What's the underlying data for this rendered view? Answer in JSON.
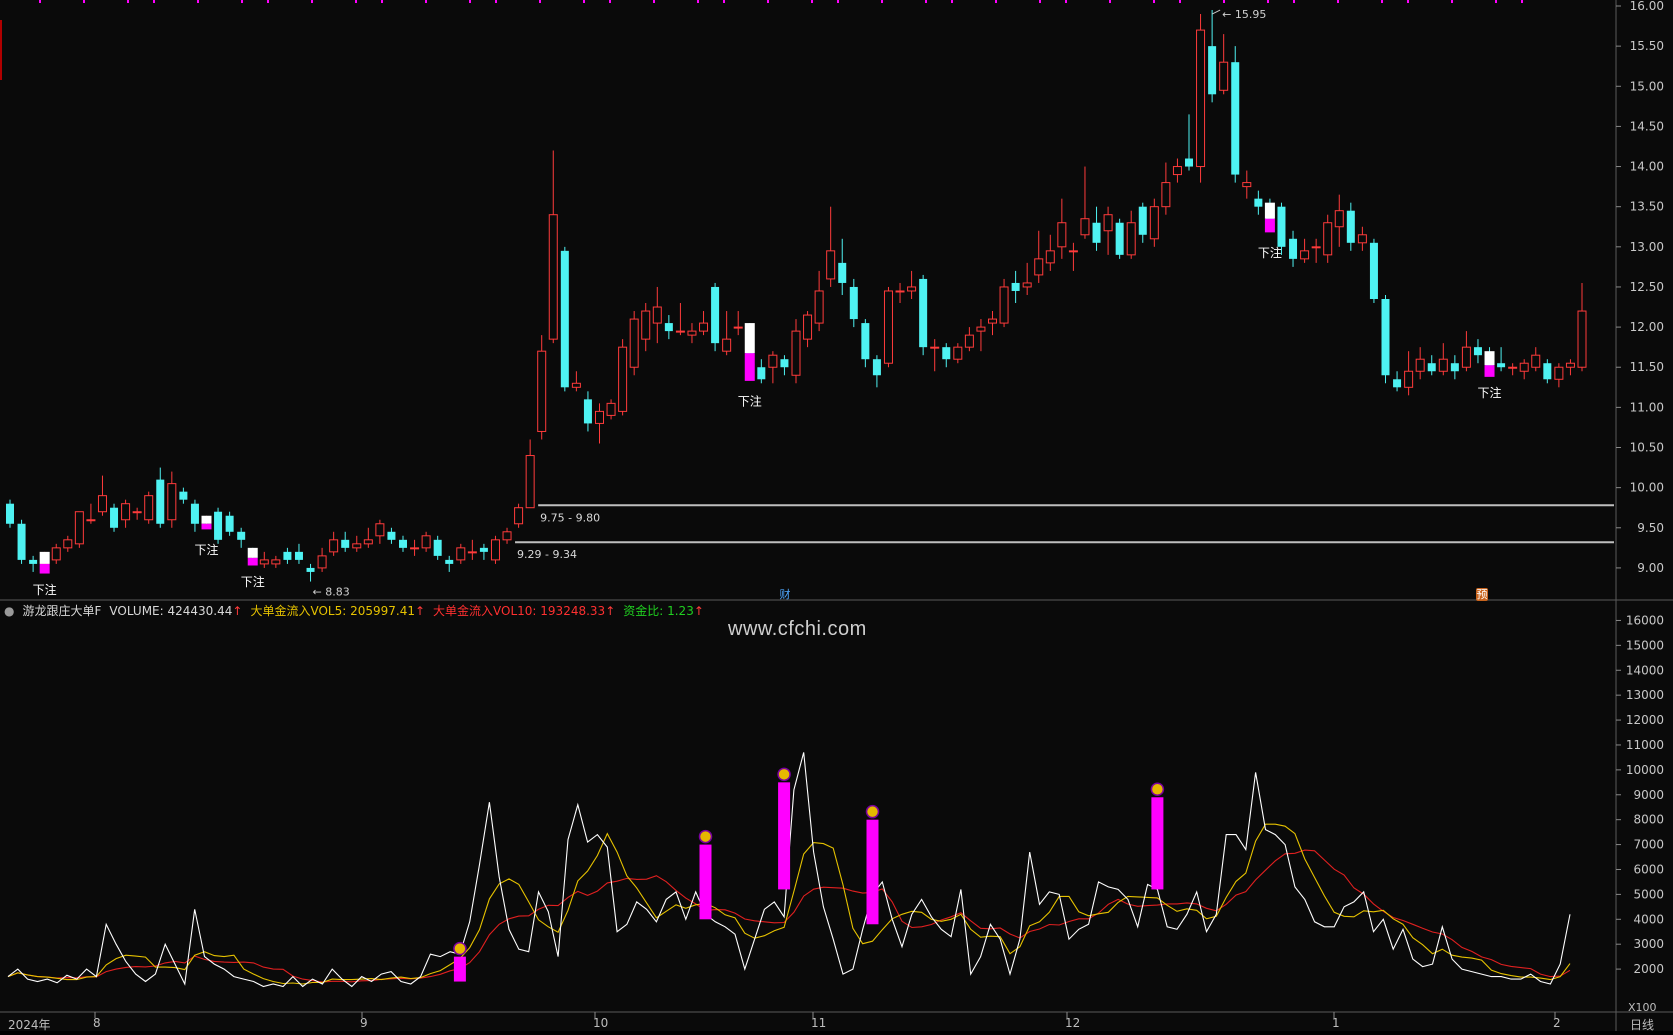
{
  "colors": {
    "up": "#ff3b3b",
    "down": "#4ef2f2",
    "bg": "#0a0a0a",
    "grid": "#2a2a2a",
    "magenta": "#ff00ff",
    "vol": "#ffffff",
    "ma5": "#e6c200",
    "ma10": "#e02020"
  },
  "indicator": {
    "name": "游龙跟庄大单F",
    "volume": "VOLUME: 424430.44",
    "vol5": "大单金流入VOL5: 205997.41",
    "vol10": "大单金流入VOL10: 193248.33",
    "ratio": "资金比: 1.23",
    "arrow": "↑"
  },
  "watermark": "www.cfchi.com",
  "x_axis": {
    "year": "2024年",
    "months": [
      "8",
      "9",
      "10",
      "11",
      "12",
      "1",
      "2"
    ]
  },
  "period": "日线",
  "vol_unit": "X100",
  "tags": {
    "cai": "财",
    "yu": "预"
  },
  "bet_label": "下注",
  "price_notes": {
    "high": "15.95",
    "low": "8.83",
    "zone1": "9.75 - 9.80",
    "zone2": "9.29 - 9.34"
  },
  "price_axis": [
    "9.00",
    "9.50",
    "10.00",
    "10.50",
    "11.00",
    "11.50",
    "12.00",
    "12.50",
    "13.00",
    "13.50",
    "14.00",
    "14.50",
    "15.00",
    "15.50",
    "16.00"
  ],
  "vol_axis": [
    "2000",
    "3000",
    "4000",
    "5000",
    "6000",
    "7000",
    "8000",
    "9000",
    "10000",
    "11000",
    "12000",
    "13000",
    "14000",
    "15000",
    "16000"
  ],
  "chart_data": {
    "type": "candlestick",
    "price_range": [
      8.7,
      16.0
    ],
    "candles": [
      [
        9.8,
        9.55,
        9.85,
        9.5
      ],
      [
        9.55,
        9.1,
        9.6,
        9.05
      ],
      [
        9.1,
        9.05,
        9.15,
        8.95
      ],
      [
        9.05,
        9.15,
        9.2,
        9.0
      ],
      [
        9.1,
        9.25,
        9.3,
        9.05
      ],
      [
        9.25,
        9.35,
        9.4,
        9.2
      ],
      [
        9.3,
        9.7,
        9.7,
        9.25
      ],
      [
        9.6,
        9.6,
        9.8,
        9.55
      ],
      [
        9.7,
        9.9,
        10.15,
        9.65
      ],
      [
        9.75,
        9.5,
        9.8,
        9.45
      ],
      [
        9.6,
        9.8,
        9.85,
        9.5
      ],
      [
        9.7,
        9.7,
        9.75,
        9.6
      ],
      [
        9.6,
        9.9,
        9.95,
        9.55
      ],
      [
        10.1,
        9.55,
        10.25,
        9.5
      ],
      [
        9.6,
        10.05,
        10.2,
        9.5
      ],
      [
        9.95,
        9.85,
        10.0,
        9.8
      ],
      [
        9.8,
        9.55,
        9.85,
        9.45
      ],
      [
        9.6,
        9.6,
        9.65,
        9.5
      ],
      [
        9.7,
        9.35,
        9.75,
        9.3
      ],
      [
        9.65,
        9.45,
        9.7,
        9.4
      ],
      [
        9.45,
        9.35,
        9.5,
        9.25
      ],
      [
        9.2,
        9.15,
        9.25,
        9.1
      ],
      [
        9.05,
        9.1,
        9.2,
        9.0
      ],
      [
        9.05,
        9.1,
        9.15,
        9.0
      ],
      [
        9.2,
        9.1,
        9.25,
        9.05
      ],
      [
        9.2,
        9.1,
        9.3,
        9.05
      ],
      [
        9.0,
        8.95,
        9.05,
        8.83
      ],
      [
        9.0,
        9.15,
        9.25,
        8.95
      ],
      [
        9.2,
        9.35,
        9.45,
        9.15
      ],
      [
        9.35,
        9.25,
        9.45,
        9.2
      ],
      [
        9.25,
        9.3,
        9.4,
        9.2
      ],
      [
        9.3,
        9.35,
        9.5,
        9.25
      ],
      [
        9.4,
        9.55,
        9.6,
        9.3
      ],
      [
        9.45,
        9.35,
        9.5,
        9.3
      ],
      [
        9.35,
        9.25,
        9.4,
        9.2
      ],
      [
        9.25,
        9.25,
        9.35,
        9.15
      ],
      [
        9.25,
        9.4,
        9.45,
        9.2
      ],
      [
        9.35,
        9.15,
        9.4,
        9.1
      ],
      [
        9.1,
        9.05,
        9.15,
        8.95
      ],
      [
        9.1,
        9.25,
        9.3,
        9.05
      ],
      [
        9.2,
        9.2,
        9.35,
        9.1
      ],
      [
        9.25,
        9.2,
        9.3,
        9.1
      ],
      [
        9.1,
        9.35,
        9.4,
        9.05
      ],
      [
        9.35,
        9.45,
        9.5,
        9.3
      ],
      [
        9.55,
        9.75,
        9.8,
        9.5
      ],
      [
        9.75,
        10.4,
        10.6,
        9.75
      ],
      [
        10.7,
        11.7,
        11.9,
        10.6
      ],
      [
        11.85,
        13.4,
        14.2,
        11.8
      ],
      [
        12.95,
        11.25,
        13.0,
        11.2
      ],
      [
        11.25,
        11.3,
        11.45,
        11.2
      ],
      [
        11.1,
        10.8,
        11.2,
        10.7
      ],
      [
        10.8,
        10.95,
        11.05,
        10.55
      ],
      [
        10.9,
        11.05,
        11.1,
        10.85
      ],
      [
        10.95,
        11.75,
        11.85,
        10.9
      ],
      [
        11.5,
        12.1,
        12.2,
        11.4
      ],
      [
        11.85,
        12.2,
        12.3,
        11.7
      ],
      [
        12.05,
        12.25,
        12.5,
        11.8
      ],
      [
        12.05,
        11.95,
        12.15,
        11.85
      ],
      [
        11.95,
        11.95,
        12.3,
        11.9
      ],
      [
        11.9,
        11.95,
        12.05,
        11.8
      ],
      [
        11.95,
        12.05,
        12.2,
        11.9
      ],
      [
        12.5,
        11.8,
        12.55,
        11.7
      ],
      [
        11.7,
        11.85,
        12.2,
        11.65
      ],
      [
        12.0,
        12.0,
        12.2,
        11.9
      ],
      [
        12.0,
        11.45,
        12.05,
        11.35
      ],
      [
        11.5,
        11.35,
        11.6,
        11.3
      ],
      [
        11.5,
        11.65,
        11.7,
        11.3
      ],
      [
        11.6,
        11.5,
        11.65,
        11.4
      ],
      [
        11.4,
        11.95,
        12.1,
        11.3
      ],
      [
        11.85,
        12.15,
        12.2,
        11.75
      ],
      [
        12.05,
        12.45,
        12.7,
        11.95
      ],
      [
        12.6,
        12.95,
        13.5,
        12.5
      ],
      [
        12.8,
        12.55,
        13.1,
        12.4
      ],
      [
        12.5,
        12.1,
        12.6,
        12.0
      ],
      [
        12.05,
        11.6,
        12.1,
        11.5
      ],
      [
        11.6,
        11.4,
        11.65,
        11.25
      ],
      [
        11.55,
        12.45,
        12.5,
        11.5
      ],
      [
        12.45,
        12.45,
        12.55,
        12.3
      ],
      [
        12.45,
        12.5,
        12.7,
        12.35
      ],
      [
        12.6,
        11.75,
        12.65,
        11.65
      ],
      [
        11.75,
        11.75,
        11.85,
        11.45
      ],
      [
        11.75,
        11.6,
        11.8,
        11.5
      ],
      [
        11.6,
        11.75,
        11.8,
        11.55
      ],
      [
        11.75,
        11.9,
        12.0,
        11.7
      ],
      [
        11.95,
        12.0,
        12.1,
        11.7
      ],
      [
        12.05,
        12.1,
        12.2,
        11.9
      ],
      [
        12.05,
        12.5,
        12.6,
        12.0
      ],
      [
        12.55,
        12.45,
        12.7,
        12.3
      ],
      [
        12.5,
        12.55,
        12.8,
        12.4
      ],
      [
        12.65,
        12.85,
        13.2,
        12.55
      ],
      [
        12.8,
        12.95,
        13.15,
        12.7
      ],
      [
        13.0,
        13.3,
        13.6,
        12.85
      ],
      [
        12.95,
        12.95,
        13.05,
        12.7
      ],
      [
        13.15,
        13.35,
        14.0,
        13.1
      ],
      [
        13.3,
        13.05,
        13.5,
        12.95
      ],
      [
        13.2,
        13.4,
        13.5,
        12.9
      ],
      [
        13.3,
        12.9,
        13.35,
        12.85
      ],
      [
        12.9,
        13.3,
        13.45,
        12.85
      ],
      [
        13.5,
        13.15,
        13.55,
        13.05
      ],
      [
        13.1,
        13.5,
        13.6,
        13.0
      ],
      [
        13.5,
        13.8,
        14.05,
        13.4
      ],
      [
        13.9,
        14.0,
        14.1,
        13.8
      ],
      [
        14.1,
        14.0,
        14.65,
        13.95
      ],
      [
        14.0,
        15.7,
        15.9,
        13.8
      ],
      [
        15.5,
        14.9,
        15.95,
        14.8
      ],
      [
        14.95,
        15.3,
        15.65,
        14.9
      ],
      [
        15.3,
        13.9,
        15.5,
        13.8
      ],
      [
        13.75,
        13.8,
        13.95,
        13.6
      ],
      [
        13.6,
        13.5,
        13.7,
        13.4
      ],
      [
        13.5,
        13.3,
        13.6,
        13.2
      ],
      [
        13.5,
        13.0,
        13.55,
        12.9
      ],
      [
        13.1,
        12.85,
        13.2,
        12.75
      ],
      [
        12.85,
        12.95,
        13.1,
        12.8
      ],
      [
        13.0,
        13.0,
        13.1,
        12.8
      ],
      [
        12.9,
        13.3,
        13.4,
        12.8
      ],
      [
        13.25,
        13.45,
        13.65,
        13.0
      ],
      [
        13.45,
        13.05,
        13.55,
        12.95
      ],
      [
        13.05,
        13.15,
        13.25,
        12.95
      ],
      [
        13.05,
        12.35,
        13.1,
        12.3
      ],
      [
        12.35,
        11.4,
        12.4,
        11.3
      ],
      [
        11.35,
        11.25,
        11.45,
        11.2
      ],
      [
        11.25,
        11.45,
        11.7,
        11.15
      ],
      [
        11.45,
        11.6,
        11.75,
        11.35
      ],
      [
        11.55,
        11.45,
        11.65,
        11.4
      ],
      [
        11.45,
        11.6,
        11.8,
        11.4
      ],
      [
        11.55,
        11.45,
        11.65,
        11.35
      ],
      [
        11.5,
        11.75,
        11.95,
        11.45
      ],
      [
        11.75,
        11.65,
        11.85,
        11.55
      ],
      [
        11.65,
        11.5,
        11.75,
        11.45
      ],
      [
        11.55,
        11.5,
        11.75,
        11.45
      ],
      [
        11.5,
        11.5,
        11.55,
        11.4
      ],
      [
        11.45,
        11.55,
        11.6,
        11.35
      ],
      [
        11.5,
        11.65,
        11.75,
        11.45
      ],
      [
        11.55,
        11.35,
        11.6,
        11.3
      ],
      [
        11.35,
        11.5,
        11.55,
        11.25
      ],
      [
        11.5,
        11.55,
        11.6,
        11.4
      ],
      [
        11.5,
        12.2,
        12.55,
        11.45
      ]
    ],
    "bet_candles": [
      3,
      17,
      21,
      64,
      109,
      128
    ],
    "volume_white": [
      1700,
      2000,
      1600,
      1500,
      1600,
      1450,
      1750,
      1600,
      2000,
      1700,
      3800,
      3000,
      2300,
      1800,
      1500,
      1800,
      3000,
      2200,
      1400,
      4400,
      2500,
      2200,
      2000,
      1700,
      1600,
      1500,
      1300,
      1400,
      1300,
      1700,
      1300,
      1600,
      1400,
      2000,
      1600,
      1300,
      1700,
      1500,
      1800,
      1900,
      1500,
      1400,
      1700,
      2600,
      2500,
      2700,
      2600,
      3900,
      6200,
      8700,
      5700,
      3600,
      2800,
      2700,
      5100,
      4300,
      2500,
      7200,
      8600,
      7100,
      7400,
      6900,
      3500,
      3800,
      4700,
      4400,
      3900,
      4800,
      5100,
      4000,
      5100,
      4200,
      3900,
      3700,
      3400,
      2000,
      3200,
      4400,
      4700,
      4100,
      9200,
      10700,
      6700,
      4500,
      3200,
      1800,
      2000,
      3600,
      5000,
      5500,
      4000,
      2900,
      4200,
      4800,
      4100,
      3600,
      3300,
      5200,
      1800,
      2500,
      3800,
      3200,
      1800,
      3200,
      6700,
      4600,
      5100,
      5000,
      3200,
      3600,
      3800,
      5500,
      5300,
      5200,
      4800,
      3700,
      5400,
      5200,
      3700,
      3600,
      4200,
      5100,
      3500,
      4200,
      7400,
      7400,
      6800,
      9900,
      7600,
      7400,
      7000,
      5300,
      4800,
      3900,
      3700,
      3700,
      4500,
      4700,
      5100,
      3500,
      4000,
      2800,
      3600,
      2400,
      2100,
      2200,
      3700,
      2400,
      2000,
      1900,
      1800,
      1700,
      1700,
      1600,
      1600,
      1800,
      1500,
      1400,
      2200,
      4200
    ]
  }
}
